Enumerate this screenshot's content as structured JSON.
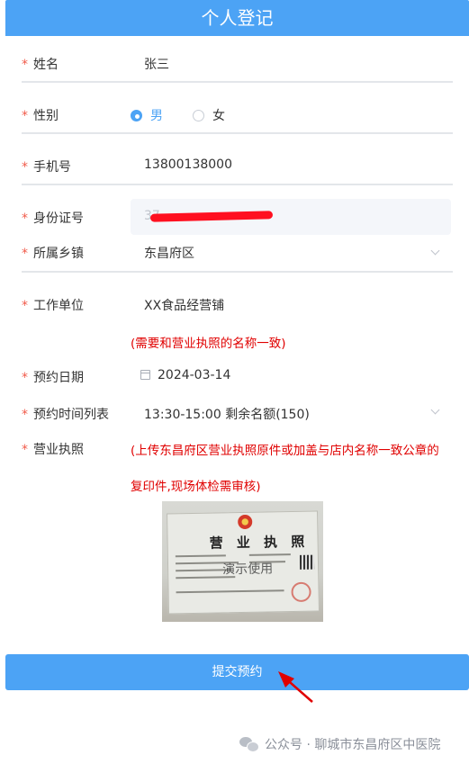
{
  "header": {
    "title": "个人登记"
  },
  "required_mark": "*",
  "form": {
    "name": {
      "label": "姓名",
      "value": "张三"
    },
    "gender": {
      "label": "性别",
      "options": [
        "男",
        "女"
      ],
      "selected": "男"
    },
    "phone": {
      "label": "手机号",
      "value": "13800138000"
    },
    "id_card": {
      "label": "身份证号",
      "value": "37"
    },
    "town": {
      "label": "所属乡镇",
      "value": "东昌府区"
    },
    "employer": {
      "label": "工作单位",
      "value": "XX食品经营铺",
      "hint": "(需要和营业执照的名称一致)"
    },
    "date": {
      "label": "预约日期",
      "value": "2024-03-14"
    },
    "timeslot": {
      "label": "预约时间列表",
      "value": "13:30-15:00 剩余名额(150)"
    },
    "license": {
      "label": "营业执照",
      "hint_line1": "(上传东昌府区营业执照原件或加盖与店内名称一致公章的",
      "hint_line2": "复印件,现场体检需审核)",
      "image": {
        "title": "营 业 执 照",
        "watermark": "演示使用"
      }
    }
  },
  "submit": {
    "label": "提交预约"
  },
  "footer": {
    "text": "公众号 · 聊城市东昌府区中医院"
  },
  "colors": {
    "primary": "#4ca3f5",
    "required": "#f15a4a",
    "hint": "#e00000"
  },
  "icons": [
    "radio-checked-icon",
    "radio-unchecked-icon",
    "chevron-down-icon",
    "calendar-icon",
    "wechat-icon",
    "arrow-pointer-icon"
  ]
}
